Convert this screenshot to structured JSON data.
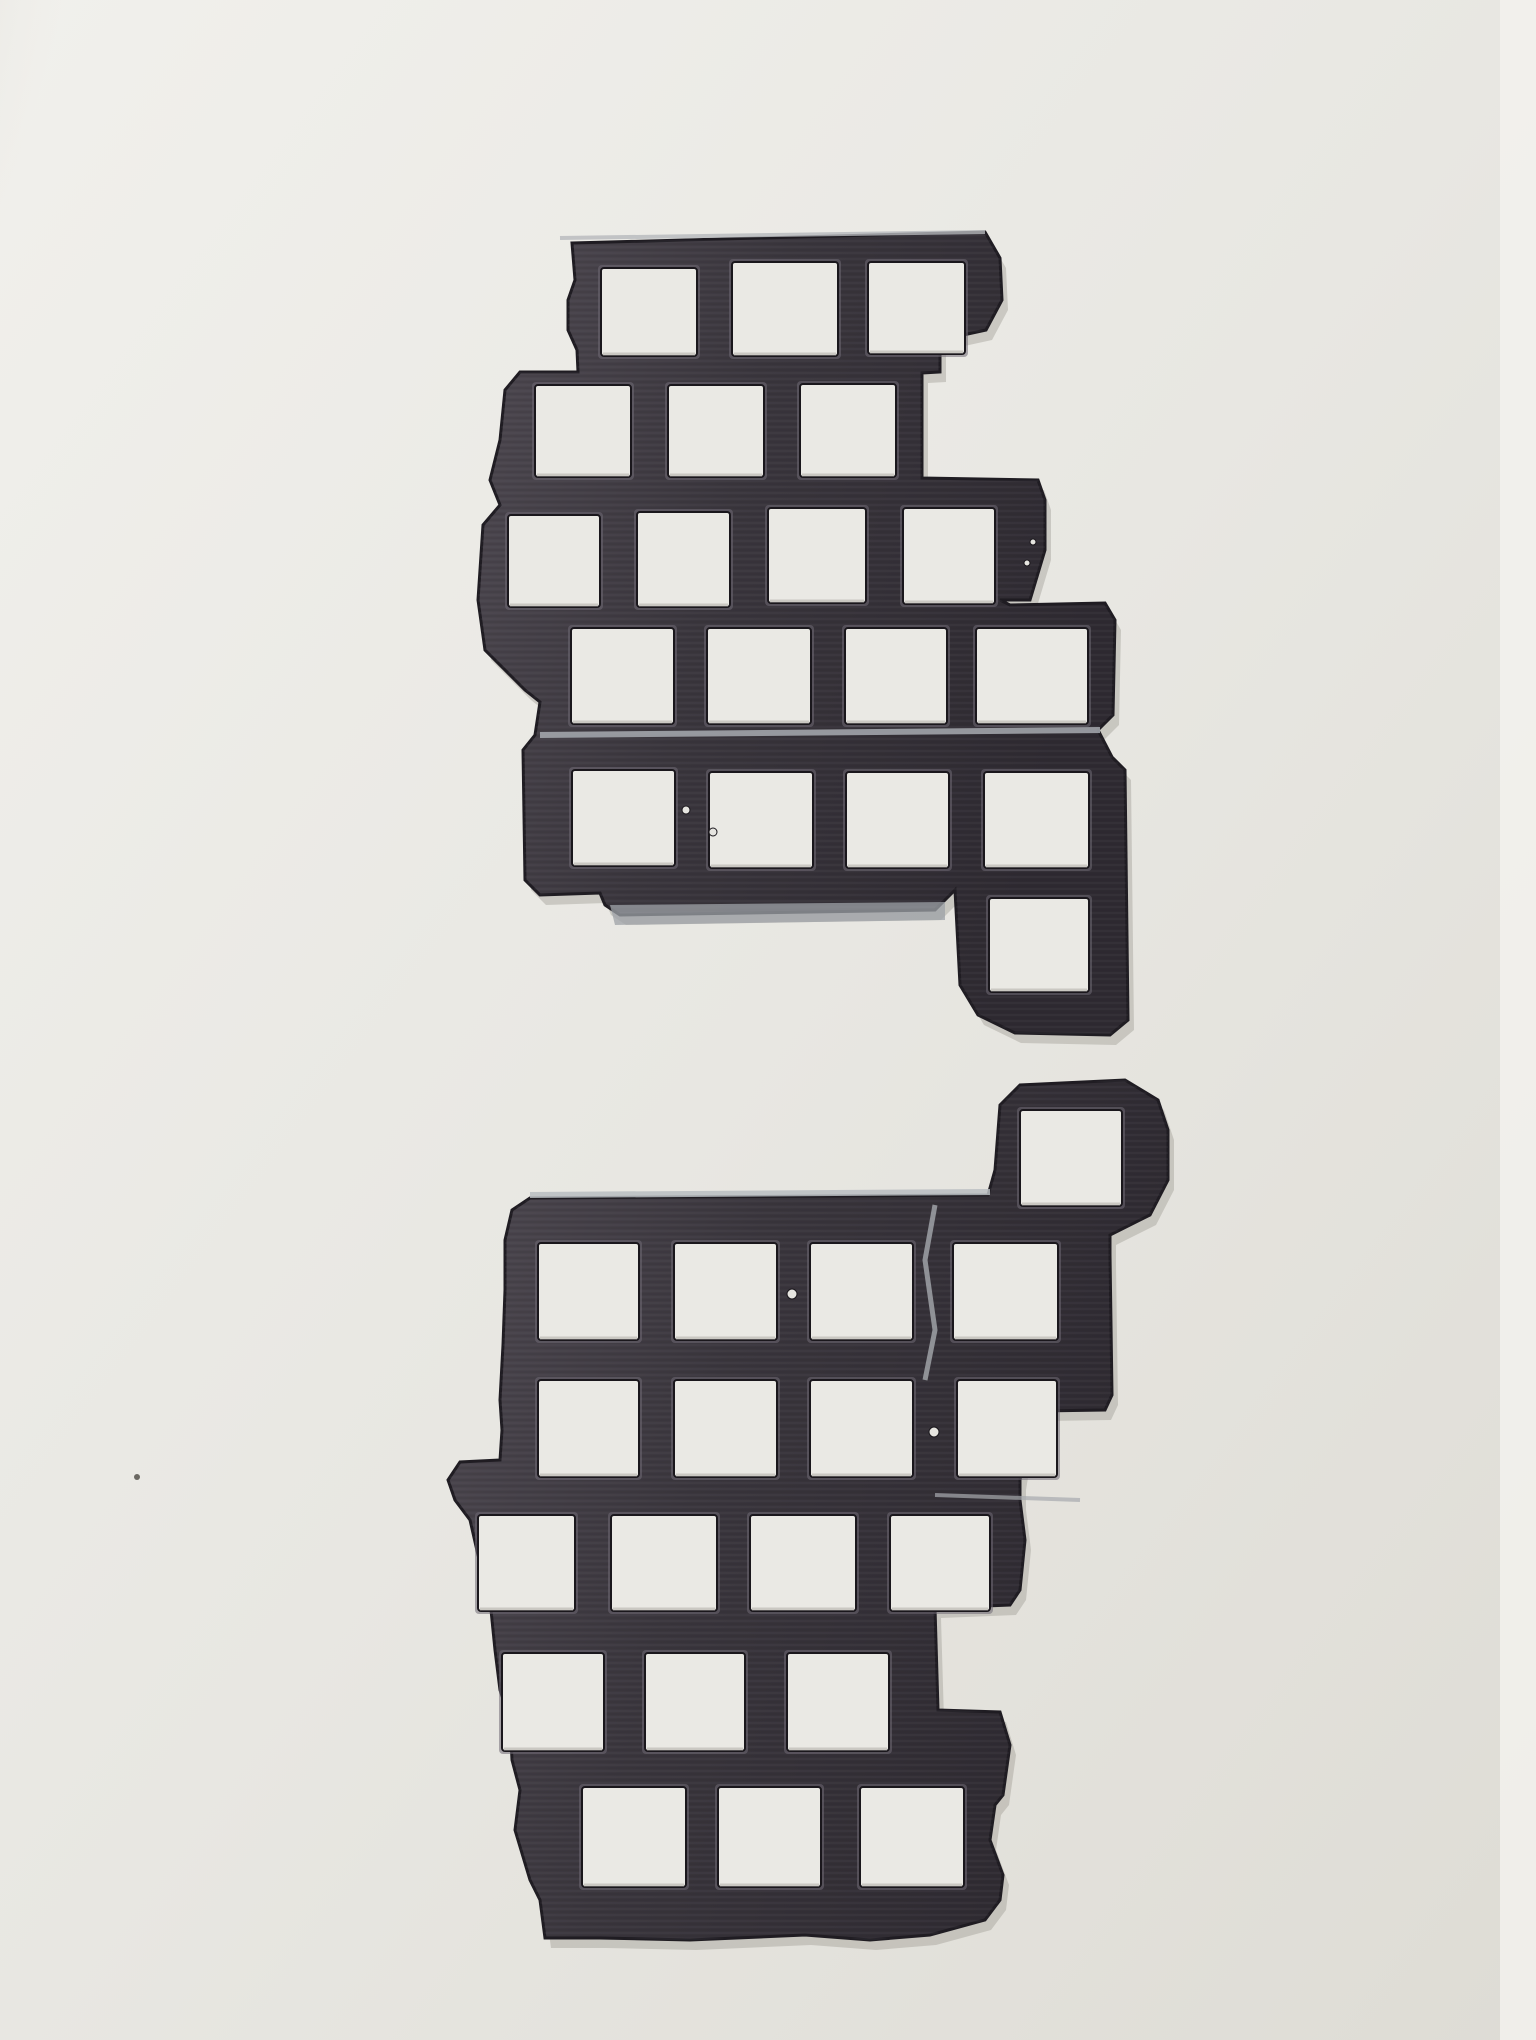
{
  "scene": {
    "description_colors": {
      "surface_light": "#ecebe6",
      "surface_mid": "#dcdad2",
      "surface_shadow": "#b9b7b0",
      "plate_dark": "#3e3a40",
      "plate_mid": "#4d4850",
      "plate_highlight": "#76717a",
      "plate_edge": "#25222a",
      "cut_edge": "#a9adb2"
    }
  },
  "plates": [
    {
      "name": "upper-plate",
      "key_grid_columns": [
        3,
        3,
        4,
        4,
        4,
        1
      ],
      "row_count": 6
    },
    {
      "name": "lower-plate",
      "key_grid_columns": [
        1,
        4,
        4,
        4,
        3,
        3
      ],
      "row_count": 6
    }
  ]
}
